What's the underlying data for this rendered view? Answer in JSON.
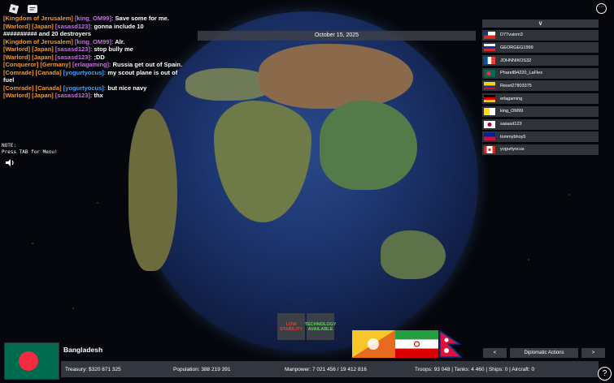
{
  "chat": [
    {
      "tag": "[Kingdom of Jerusalem]",
      "tag_color": "#f29c2b",
      "user": "[king_OM99]:",
      "user_color": "#c774e0",
      "text": "Save some for me."
    },
    {
      "tag": "[Warlord] [Japan]",
      "tag_color": "#f29c2b",
      "user": "[sasasd123]:",
      "user_color": "#c774e0",
      "text": "gonna include 10"
    },
    {
      "tag": "",
      "tag_color": "#f29c2b",
      "user": "",
      "user_color": "#c774e0",
      "text": "########## and 20 destroyers"
    },
    {
      "tag": "[Kingdom of Jerusalem]",
      "tag_color": "#f29c2b",
      "user": "[king_OM99]:",
      "user_color": "#c774e0",
      "text": "Alr."
    },
    {
      "tag": "[Warlord] [Japan]",
      "tag_color": "#f29c2b",
      "user": "[sasasd123]:",
      "user_color": "#c774e0",
      "text": "stop bully me"
    },
    {
      "tag": "[Warlord] [Japan]",
      "tag_color": "#f29c2b",
      "user": "[sasasd123]:",
      "user_color": "#c774e0",
      "text": ";DD"
    },
    {
      "tag": "[Conqueror] [Germany]",
      "tag_color": "#f29c2b",
      "user": "[erlagaming]:",
      "user_color": "#c774e0",
      "text": "Russia get out of Spain."
    },
    {
      "tag": "[Comrade] [Canada]",
      "tag_color": "#f29c2b",
      "user": "[yogurtyocus]:",
      "user_color": "#46a6ff",
      "text": "my scout plane is out of"
    },
    {
      "tag": "",
      "tag_color": "#f29c2b",
      "user": "",
      "user_color": "#46a6ff",
      "text": "fuel"
    },
    {
      "tag": "[Comrade] [Canada]",
      "tag_color": "#f29c2b",
      "user": "[yogurtyocus]:",
      "user_color": "#46a6ff",
      "text": "but nice navy"
    },
    {
      "tag": "[Warlord] [Japan]",
      "tag_color": "#f29c2b",
      "user": "[sasasd123]:",
      "user_color": "#c774e0",
      "text": "thx"
    }
  ],
  "date": "October 15, 2025",
  "note": {
    "line1": "NOTE:",
    "line2": "Press TAB for Menu!"
  },
  "players": {
    "collapse_label": "∨",
    "list": [
      {
        "name": "D77vuiom3",
        "flag": "cl"
      },
      {
        "name": "GEORGEG1999",
        "flag": "ru"
      },
      {
        "name": "JOHNNIKOS32",
        "flag": "fr"
      },
      {
        "name": "Pharell94220_LaFlex",
        "flag": "bd"
      },
      {
        "name": "Reset27803375",
        "flag": "co"
      },
      {
        "name": "erlagaming",
        "flag": "de"
      },
      {
        "name": "king_OM99",
        "flag": "va"
      },
      {
        "name": "sasasd123",
        "flag": "jp"
      },
      {
        "name": "tommybhoy5",
        "flag": "ht"
      },
      {
        "name": "yogurtyocus",
        "flag": "ca"
      }
    ]
  },
  "badges": {
    "stability": "LOW STABILITY",
    "tech": "TECHNOLOGY AVAILABLE"
  },
  "neighbors": [
    "bhutan",
    "iran",
    "nepal"
  ],
  "diplomacy": {
    "prev": "<",
    "label": "Diplomatic Actions",
    "next": ">"
  },
  "country": {
    "name": "Bangladesh"
  },
  "stats": {
    "treasury": "Treasury:  $320 871 325",
    "population": "Population: 388 219 391",
    "manpower": "Manpower:  7 021 456  /  19 412 816",
    "military": "Troops: 93 048  |  Tanks: 4 460  |  Ships: 0  |  Aircraft: 0"
  },
  "icons": {
    "roblox": "roblox-logo-icon",
    "chat": "chat-icon",
    "menu": "menu-dots-icon",
    "speaker": "speaker-icon",
    "help": "help-icon"
  }
}
